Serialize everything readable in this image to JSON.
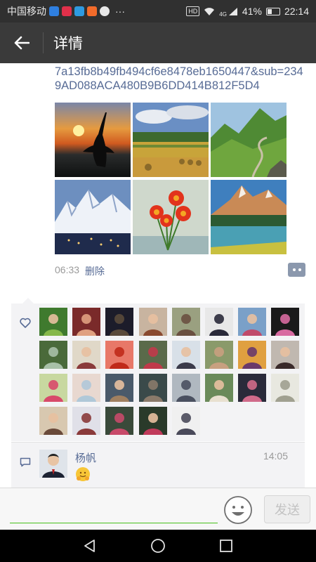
{
  "status_bar": {
    "carrier": "中国移动",
    "signal_label": "4G",
    "battery": "41%",
    "battery_level": 0.41,
    "time": "22:14",
    "more": "···",
    "hd": "HD"
  },
  "title_bar": {
    "title": "详情",
    "back_icon": "arrow-left-icon"
  },
  "post": {
    "link_text": "7a13fb8b49fb494cf6e8478eb1650447&sub=2349AD088ACA480B9B6DD414B812F5D4",
    "time": "06:33",
    "delete_label": "删除",
    "photos": [
      "crane-sunset",
      "hay-bales-field",
      "green-mountains",
      "snowy-village",
      "red-gerbera-flowers",
      "mountain-lake"
    ]
  },
  "likes": {
    "icon": "heart-outline-icon",
    "avatar_count": 29
  },
  "comment": {
    "icon": "comment-bubble-icon",
    "name": "杨帆",
    "time": "14:05",
    "content_icon": "hugging-face-emoji"
  },
  "input": {
    "value": "",
    "emoji_icon": "smiley-icon",
    "send_label": "发送"
  },
  "nav": {
    "back_icon": "triangle-back-icon",
    "home_icon": "circle-home-icon",
    "recent_icon": "square-recent-icon"
  },
  "colors": {
    "link": "#576b95",
    "title_bar": "#3a3a3a",
    "input_underline": "#45c01a"
  }
}
